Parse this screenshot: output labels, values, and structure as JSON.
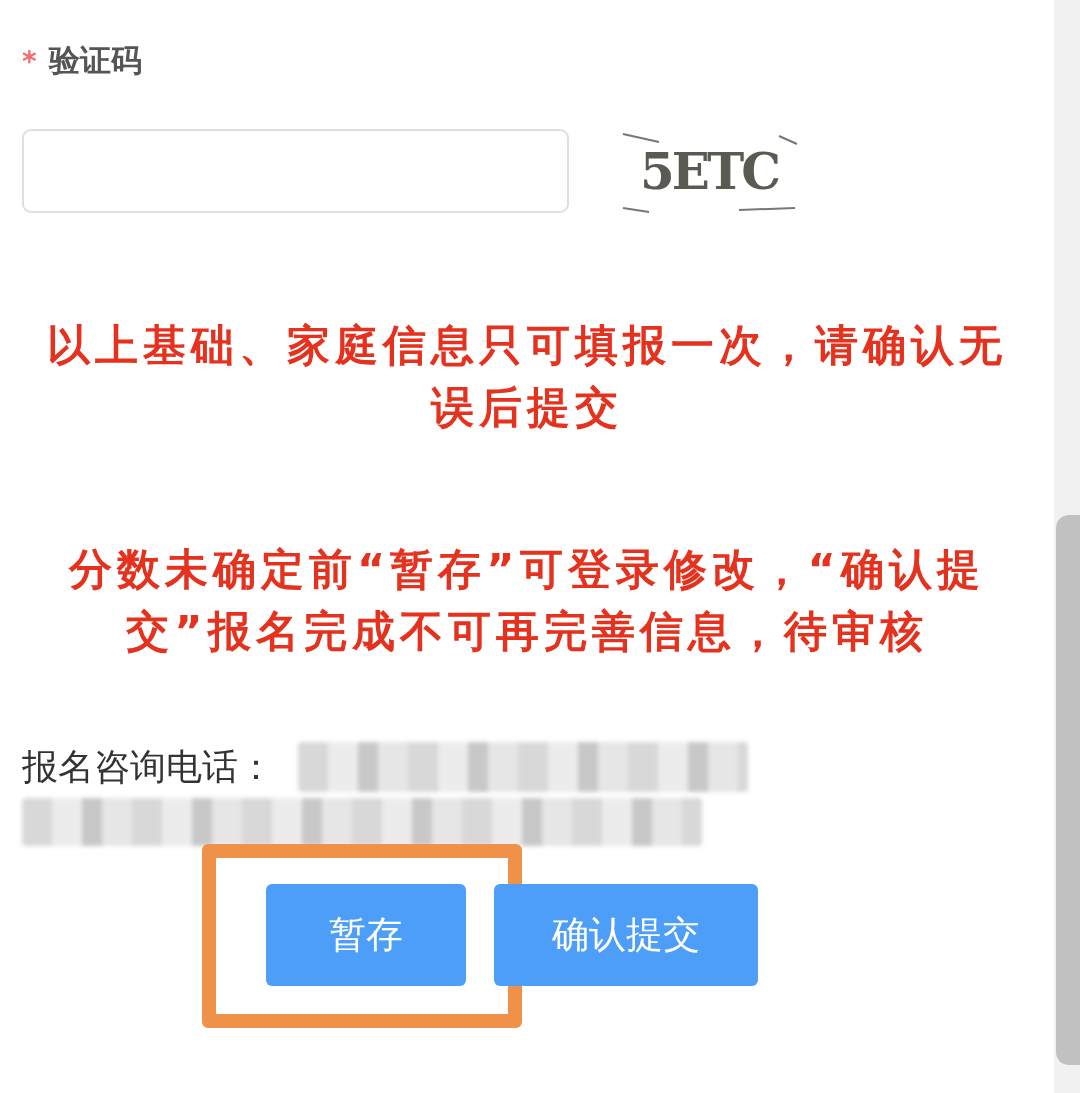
{
  "captcha_field": {
    "label": "验证码",
    "required_mark": "*",
    "code": "5ETC"
  },
  "notices": [
    "以上基础、家庭信息只可填报一次，请确认无误后提交",
    "分数未确定前“暂存”可登录修改，“确认提交”报名完成不可再完善信息，待审核"
  ],
  "contact": {
    "label": "报名咨询电话："
  },
  "buttons": [
    {
      "label": "暂存",
      "highlighted": true
    },
    {
      "label": "确认提交",
      "highlighted": false
    }
  ]
}
